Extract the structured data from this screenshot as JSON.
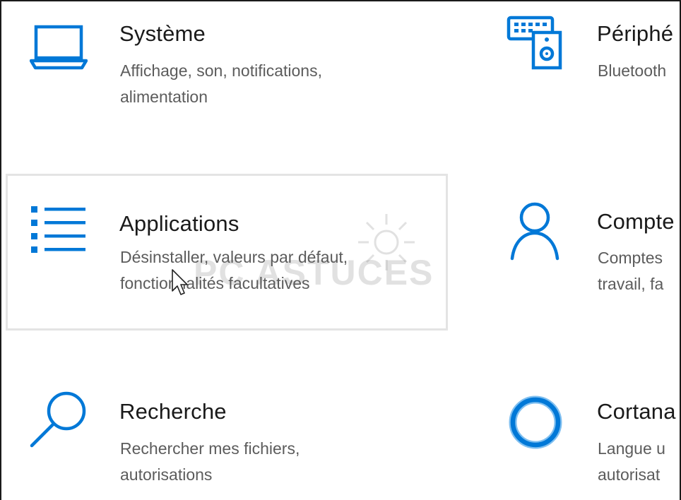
{
  "tiles": {
    "system": {
      "title": "Système",
      "desc": "Affichage, son, notifications,\nalimentation"
    },
    "devices": {
      "title": "Périphé",
      "desc": "Bluetooth"
    },
    "apps": {
      "title": "Applications",
      "desc": "Désinstaller, valeurs par défaut,\nfonctionnalités facultatives"
    },
    "accounts": {
      "title": "Compte",
      "desc": "Comptes\ntravail, fa"
    },
    "search": {
      "title": "Recherche",
      "desc": "Rechercher mes fichiers,\nautorisations"
    },
    "cortana": {
      "title": "Cortana",
      "desc": "Langue u\nautorisat"
    }
  },
  "watermark": {
    "text": "PC ASTUCES"
  },
  "colors": {
    "accent": "#0078d7",
    "title": "#1a1a1a",
    "desc": "#5c5c5c",
    "hover_border": "#e4e4e4"
  },
  "icons": {
    "system": "laptop-icon",
    "devices": "keyboard-speaker-icon",
    "apps": "app-list-icon",
    "accounts": "person-icon",
    "search": "magnifier-icon",
    "cortana": "cortana-ring-icon"
  }
}
